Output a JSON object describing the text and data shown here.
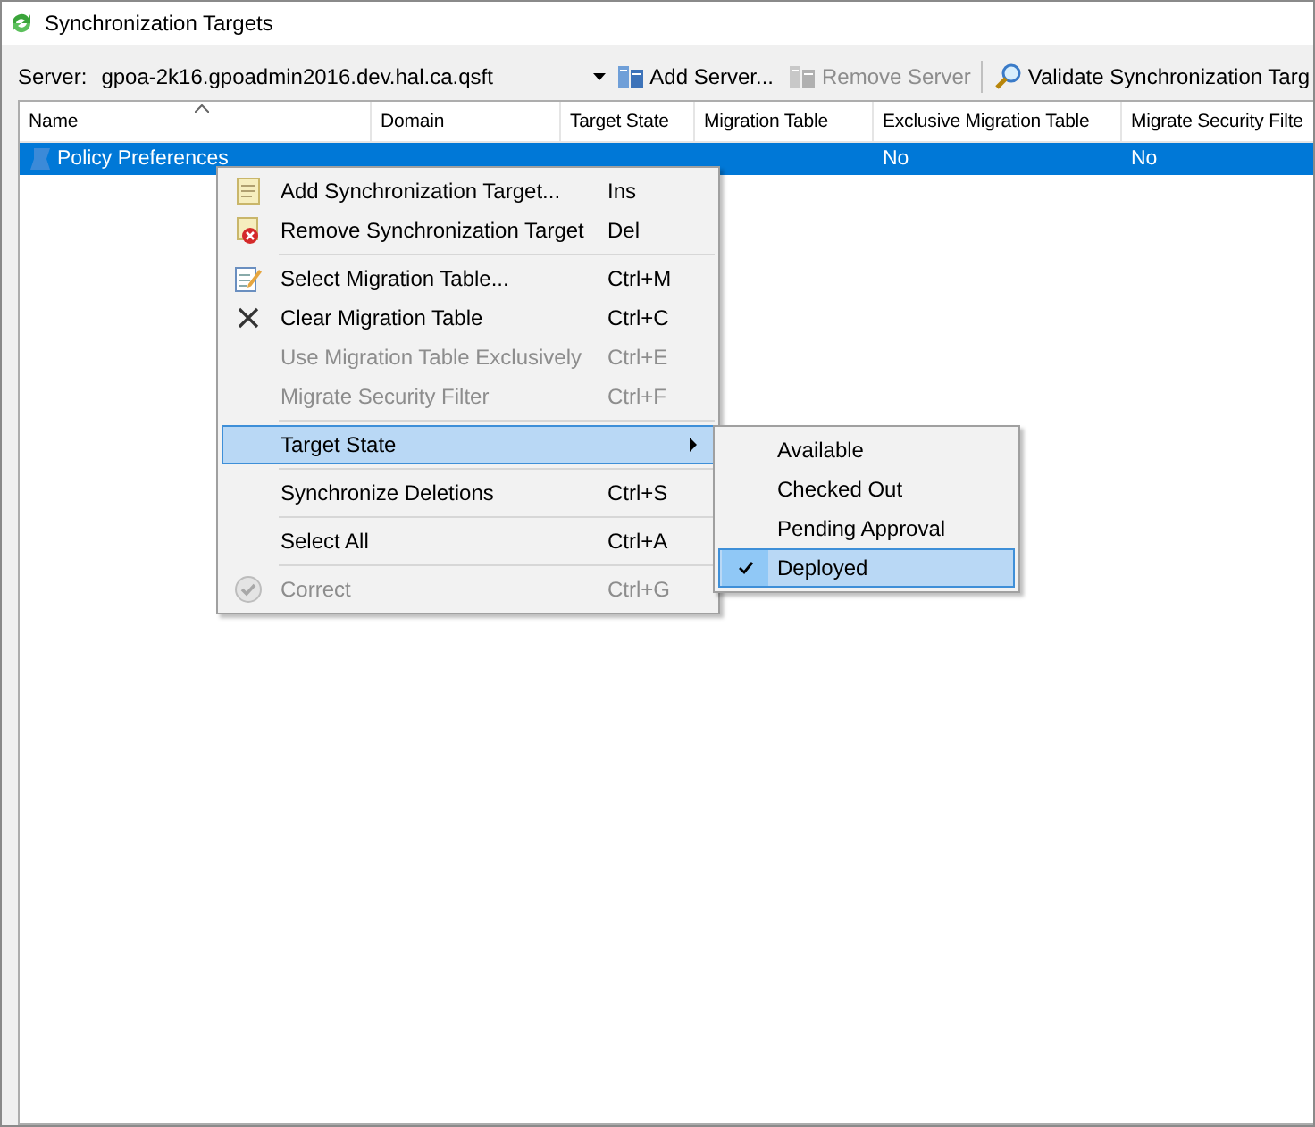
{
  "window": {
    "title": "Synchronization Targets"
  },
  "toolbar": {
    "server_label": "Server:",
    "server_value": "gpoa-2k16.gpoadmin2016.dev.hal.ca.qsft",
    "buttons": [
      {
        "label": "Add Server...",
        "disabled": false
      },
      {
        "label": "Remove Server",
        "disabled": true
      },
      {
        "label": "Validate Synchronization Targ",
        "disabled": false
      }
    ]
  },
  "table": {
    "columns": [
      {
        "label": "Name",
        "sorted": true
      },
      {
        "label": "Domain",
        "sorted": false
      },
      {
        "label": "Target State",
        "sorted": false
      },
      {
        "label": "Migration Table",
        "sorted": false
      },
      {
        "label": "Exclusive Migration Table",
        "sorted": false
      },
      {
        "label": "Migrate Security Filte",
        "sorted": false
      }
    ],
    "rows": [
      {
        "selected": true,
        "cells": [
          "Policy Preferences",
          null,
          null,
          null,
          "No",
          "No"
        ]
      }
    ]
  },
  "context_menu": {
    "groups": [
      [
        {
          "label": "Add Synchronization Target...",
          "shortcut": "Ins",
          "disabled": false,
          "selected": false
        },
        {
          "label": "Remove Synchronization Target",
          "shortcut": "Del",
          "disabled": false,
          "selected": false
        }
      ],
      [
        {
          "label": "Select Migration Table...",
          "shortcut": "Ctrl+M",
          "disabled": false,
          "selected": false
        },
        {
          "label": "Clear Migration Table",
          "shortcut": "Ctrl+C",
          "disabled": false,
          "selected": false
        },
        {
          "label": "Use Migration Table Exclusively",
          "shortcut": "Ctrl+E",
          "disabled": true,
          "selected": false
        },
        {
          "label": "Migrate Security Filter",
          "shortcut": "Ctrl+F",
          "disabled": true,
          "selected": false
        }
      ],
      [
        {
          "label": "Target State",
          "disabled": false,
          "selected": true,
          "submenu": true
        }
      ],
      [
        {
          "label": "Synchronize Deletions",
          "shortcut": "Ctrl+S",
          "disabled": false,
          "selected": false
        }
      ],
      [
        {
          "label": "Select All",
          "shortcut": "Ctrl+A",
          "disabled": false,
          "selected": false
        }
      ],
      [
        {
          "label": "Correct",
          "shortcut": "Ctrl+G",
          "disabled": true,
          "selected": false
        }
      ]
    ],
    "submenu": [
      {
        "label": "Available",
        "checked": false,
        "selected": false
      },
      {
        "label": "Checked Out",
        "checked": false,
        "selected": false
      },
      {
        "label": "Pending Approval",
        "checked": false,
        "selected": false
      },
      {
        "label": "Deployed",
        "checked": true,
        "selected": true
      }
    ]
  }
}
